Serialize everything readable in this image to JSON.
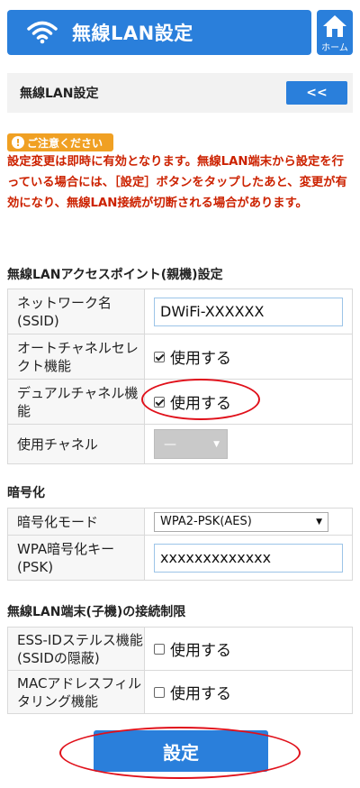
{
  "header": {
    "title": "無線LAN設定",
    "home_label": "ホーム"
  },
  "subbar": {
    "title": "無線LAN設定",
    "back_label": "<<"
  },
  "notice": {
    "badge": "ご注意ください",
    "text": "設定変更は即時に有効となります。無線LAN端末から設定を行っている場合には、［設定］ボタンをタップしたあと、変更が有効になり、無線LAN接続が切断される場合があります。"
  },
  "ap_section": {
    "title": "無線LANアクセスポイント(親機)設定",
    "ssid_label": "ネットワーク名(SSID)",
    "ssid_value": "DWiFi-XXXXXX",
    "autochannel_label": "オートチャネルセレクト機能",
    "autochannel_check": "使用する",
    "dualchannel_label": "デュアルチャネル機能",
    "dualchannel_check": "使用する",
    "channel_label": "使用チャネル",
    "channel_value": "—"
  },
  "encryption_section": {
    "title": "暗号化",
    "mode_label": "暗号化モード",
    "mode_value": "WPA2-PSK(AES)",
    "key_label": "WPA暗号化キー(PSK)",
    "key_value": "xxxxxxxxxxxxx"
  },
  "restriction_section": {
    "title": "無線LAN端末(子機)の接続制限",
    "stealth_label": "ESS-IDステルス機能(SSIDの隠蔽)",
    "stealth_check": "使用する",
    "mac_label": "MACアドレスフィルタリング機能",
    "mac_check": "使用する"
  },
  "submit_label": "設定",
  "colors": {
    "primary": "#2a7fdb",
    "notice": "#cc2200",
    "badge": "#f0a023",
    "annotation": "#e0101a"
  }
}
